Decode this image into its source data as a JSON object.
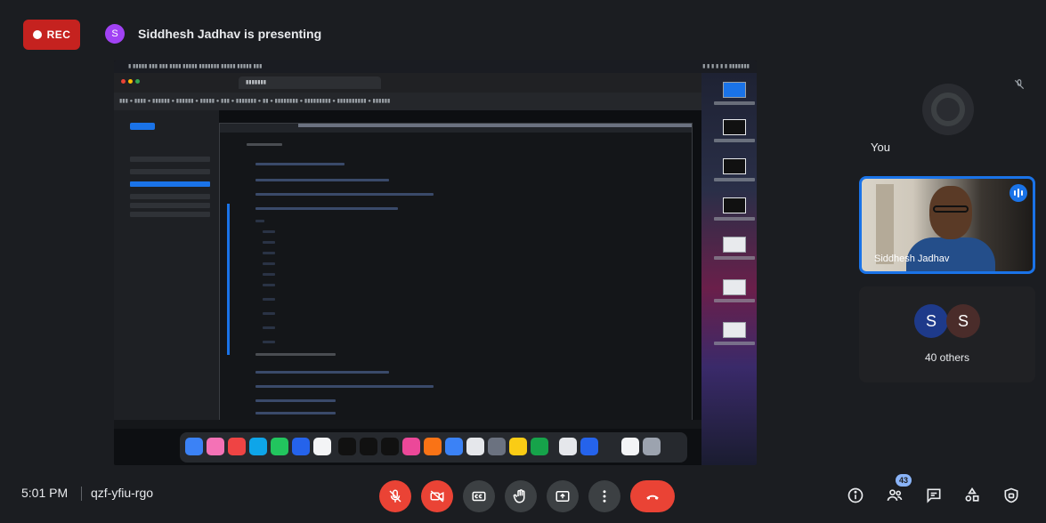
{
  "recording": {
    "label": "REC",
    "color": "#c5221f"
  },
  "presenter": {
    "initial": "S",
    "text": "Siddhesh Jadhav is presenting",
    "avatar_color": "#a142f4"
  },
  "self_tile": {
    "label": "You"
  },
  "speaker_tile": {
    "name": "Siddhesh Jadhav"
  },
  "others": {
    "avatars": [
      {
        "initial": "S",
        "color": "#1e3a8a"
      },
      {
        "initial": "S",
        "color": "#4a2c2a"
      }
    ],
    "label": "40 others"
  },
  "footer": {
    "time": "5:01 PM",
    "meeting_code": "qzf-yfiu-rgo",
    "people_count": "43"
  },
  "icons": {
    "mic": "mic-off-icon",
    "camera": "camera-off-icon",
    "captions": "captions-icon",
    "hand": "raise-hand-icon",
    "present": "present-screen-icon",
    "more": "more-options-icon",
    "end": "end-call-icon",
    "info": "meeting-info-icon",
    "people": "people-icon",
    "chat": "chat-icon",
    "activities": "activities-icon",
    "host": "host-controls-icon"
  },
  "colors": {
    "accent": "#1a73e8",
    "danger": "#ea4335",
    "control_bg": "#3c4043",
    "background": "#1b1d21"
  }
}
